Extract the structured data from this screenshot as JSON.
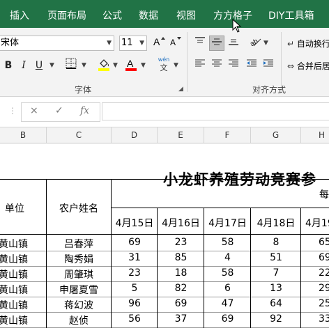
{
  "ribbon": {
    "tabs": [
      "插入",
      "页面布局",
      "公式",
      "数据",
      "视图",
      "方方格子",
      "DIY工具箱"
    ],
    "font_name": "宋体",
    "font_size": "11",
    "bold_label": "B",
    "italic_label": "I",
    "underline_label": "U",
    "phonetic_top": "wén",
    "phonetic_bottom": "文",
    "wrap_text_label": "自动换行",
    "merge_center_label": "合并后居中",
    "font_group_label": "字体",
    "align_group_label": "对齐方式",
    "fill_color": "#ffff00",
    "font_color": "#ff0000",
    "accent": "#217346"
  },
  "formula_bar": {
    "fx_label": "fx",
    "cancel_icon": "×",
    "enter_icon": "✓",
    "value": ""
  },
  "columns": [
    "B",
    "C",
    "D",
    "E",
    "F",
    "G",
    "H"
  ],
  "sheet": {
    "title": "小龙虾养殖劳动竞赛参",
    "header_unit": "单位",
    "header_name": "农户姓名",
    "header_every": "每",
    "dates": [
      "4月15日",
      "4月16日",
      "4月17日",
      "4月18日",
      "4月19"
    ],
    "rows": [
      {
        "unit": "黄山镇",
        "name": "吕春萍",
        "values": [
          "69",
          "23",
          "58",
          "8",
          "65"
        ]
      },
      {
        "unit": "黄山镇",
        "name": "陶秀娟",
        "values": [
          "31",
          "85",
          "4",
          "51",
          "69"
        ]
      },
      {
        "unit": "黄山镇",
        "name": "周肇琪",
        "values": [
          "23",
          "18",
          "58",
          "7",
          "22"
        ]
      },
      {
        "unit": "黄山镇",
        "name": "申屠夏雪",
        "values": [
          "5",
          "82",
          "6",
          "13",
          "29"
        ]
      },
      {
        "unit": "黄山镇",
        "name": "蒋幻波",
        "values": [
          "96",
          "69",
          "47",
          "64",
          "25"
        ]
      },
      {
        "unit": "黄山镇",
        "name": "赵侦",
        "values": [
          "56",
          "37",
          "69",
          "92",
          "33"
        ]
      }
    ]
  }
}
